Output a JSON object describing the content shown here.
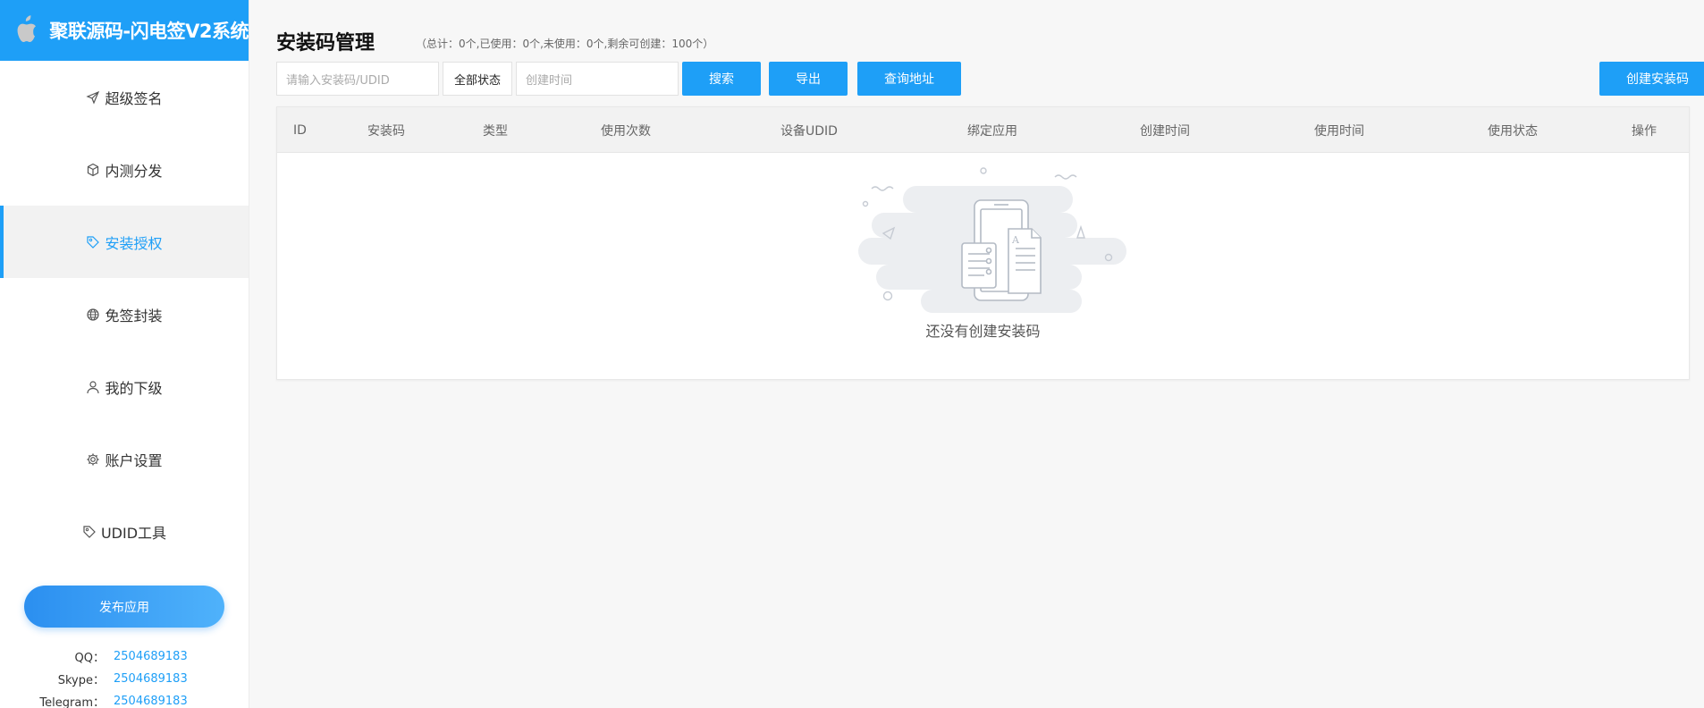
{
  "brand": {
    "title": "聚联源码-闪电签V2系统",
    "logo_icon": "apple-icon"
  },
  "sidebar": {
    "items": [
      {
        "label": "超级签名",
        "icon": "paper-plane-icon",
        "active": false
      },
      {
        "label": "内测分发",
        "icon": "cube-icon",
        "active": false
      },
      {
        "label": "安装授权",
        "icon": "tag-icon",
        "active": true
      },
      {
        "label": "免签封装",
        "icon": "globe-icon",
        "active": false
      },
      {
        "label": "我的下级",
        "icon": "user-icon",
        "active": false
      },
      {
        "label": "账户设置",
        "icon": "gear-icon",
        "active": false
      },
      {
        "label": "UDID工具",
        "icon": "tag-icon",
        "active": false
      }
    ],
    "publish_label": "发布应用",
    "contacts": [
      {
        "key": "QQ：",
        "value": "2504689183"
      },
      {
        "key": "Skype：",
        "value": "2504689183"
      },
      {
        "key": "Telegram：",
        "value": "2504689183"
      }
    ]
  },
  "main": {
    "title": "安装码管理",
    "stats": "（总计：0个,已使用：0个,未使用：0个,剩余可创建：100个）",
    "search_placeholder": "请输入安装码/UDID",
    "status_select": "全部状态",
    "date_placeholder": "创建时间",
    "search_label": "搜索",
    "export_label": "导出",
    "query_label": "查询地址",
    "create_label": "创建安装码",
    "columns": [
      "ID",
      "安装码",
      "类型",
      "使用次数",
      "设备UDID",
      "绑定应用",
      "创建时间",
      "使用时间",
      "使用状态",
      "操作"
    ],
    "empty_text": "还没有创建安装码"
  },
  "colors": {
    "accent": "#1e9ff7",
    "active_bg": "#f2f2f2",
    "page_bg": "#f7f7f7"
  }
}
